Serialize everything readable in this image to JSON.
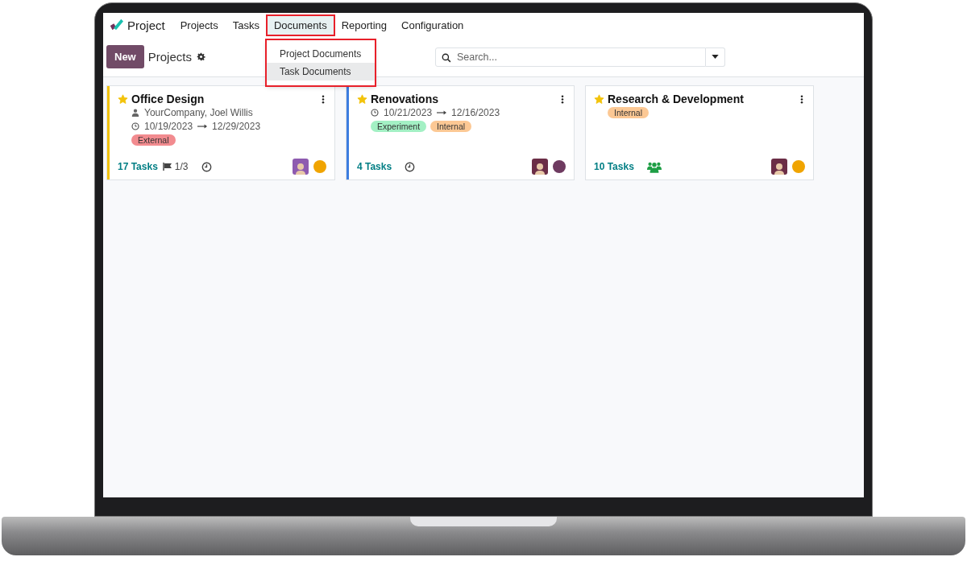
{
  "app": {
    "name": "Project"
  },
  "menu": [
    {
      "label": "Projects",
      "selected": false,
      "highlighted": false
    },
    {
      "label": "Tasks",
      "selected": false,
      "highlighted": false
    },
    {
      "label": "Documents",
      "selected": true,
      "highlighted": true
    },
    {
      "label": "Reporting",
      "selected": false,
      "highlighted": false
    },
    {
      "label": "Configuration",
      "selected": false,
      "highlighted": false
    }
  ],
  "dropdown": {
    "highlighted": true,
    "items": [
      {
        "label": "Project Documents",
        "selected": false
      },
      {
        "label": "Task Documents",
        "selected": true
      }
    ]
  },
  "control_panel": {
    "new_button": "New",
    "title": "Projects"
  },
  "search": {
    "placeholder": "Search..."
  },
  "projects": [
    {
      "name": "Office Design",
      "starred": true,
      "color": "#f3c30a",
      "customer": "YourCompany, Joel Willis",
      "start": "10/19/2023",
      "end": "12/29/2023",
      "tags": [
        {
          "label": "External",
          "color": "#f28b8f"
        }
      ],
      "tasks": "17 Tasks",
      "milestones": "1/3",
      "activity": {
        "kind": "clock"
      },
      "avatar": {
        "color": "#8e5bb0"
      },
      "status": {
        "color": "#f0a400"
      }
    },
    {
      "name": "Renovations",
      "starred": true,
      "color": "#3c7de0",
      "start": "10/21/2023",
      "end": "12/16/2023",
      "tags": [
        {
          "label": "Experiment",
          "color": "#a3f0c4"
        },
        {
          "label": "Internal",
          "color": "#fcc894"
        }
      ],
      "tasks": "4 Tasks",
      "activity": {
        "kind": "clock"
      },
      "avatar": {
        "color": "#6b2d46"
      },
      "status": {
        "color": "#6e3a60"
      }
    },
    {
      "name": "Research & Development",
      "starred": true,
      "tags": [
        {
          "label": "Internal",
          "color": "#fcc894"
        }
      ],
      "tasks": "10 Tasks",
      "activity": {
        "kind": "people"
      },
      "avatar": {
        "color": "#6b2d46"
      },
      "status": {
        "color": "#f0a400"
      }
    }
  ]
}
